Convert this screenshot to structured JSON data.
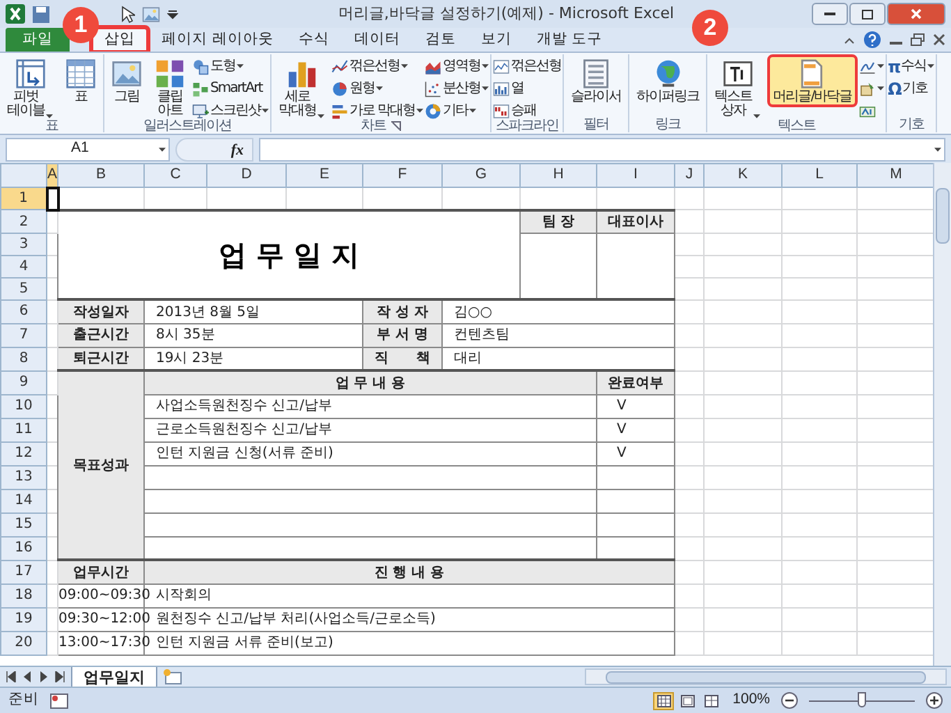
{
  "title_bar": {
    "title": "머리글,바닥글 설정하기(예제) - Microsoft Excel"
  },
  "annotations": [
    {
      "label": "1"
    },
    {
      "label": "2"
    }
  ],
  "ribbon_tabs": [
    {
      "label": "파일",
      "kind": "file",
      "selected": false,
      "highlighted": false
    },
    {
      "label": "삽입",
      "kind": "tab",
      "selected": true,
      "highlighted": true
    },
    {
      "label": "페이지 레이아웃",
      "kind": "tab",
      "selected": false,
      "highlighted": false
    },
    {
      "label": "수식",
      "kind": "tab",
      "selected": false,
      "highlighted": false
    },
    {
      "label": "데이터",
      "kind": "tab",
      "selected": false,
      "highlighted": false
    },
    {
      "label": "검토",
      "kind": "tab",
      "selected": false,
      "highlighted": false
    },
    {
      "label": "보기",
      "kind": "tab",
      "selected": false,
      "highlighted": false
    },
    {
      "label": "개발 도구",
      "kind": "tab",
      "selected": false,
      "highlighted": false
    }
  ],
  "ribbon_groups": [
    {
      "label": "표",
      "launcher": false,
      "commands": [
        {
          "kind": "large",
          "label": "피벗\n테이블",
          "dropdown": true,
          "highlighted": false
        },
        {
          "kind": "large",
          "label": "표",
          "dropdown": false,
          "highlighted": false
        }
      ]
    },
    {
      "label": "일러스트레이션",
      "launcher": false,
      "commands": [
        {
          "kind": "large",
          "label": "그림",
          "dropdown": false,
          "highlighted": false
        },
        {
          "kind": "large",
          "label": "클립\n아트",
          "dropdown": false,
          "highlighted": false
        },
        {
          "kind": "small",
          "label": "도형",
          "dropdown": true
        },
        {
          "kind": "small",
          "label": "SmartArt",
          "dropdown": false
        },
        {
          "kind": "small",
          "label": "스크린샷",
          "dropdown": true
        }
      ]
    },
    {
      "label": "차트",
      "launcher": true,
      "commands": [
        {
          "kind": "large",
          "label": "세로\n막대형",
          "dropdown": true,
          "highlighted": false
        },
        {
          "kind": "small",
          "label": "꺾은선형",
          "dropdown": true
        },
        {
          "kind": "small",
          "label": "원형",
          "dropdown": true
        },
        {
          "kind": "small",
          "label": "가로 막대형",
          "dropdown": true
        },
        {
          "kind": "small",
          "label": "영역형",
          "dropdown": true
        },
        {
          "kind": "small",
          "label": "분산형",
          "dropdown": true
        },
        {
          "kind": "small",
          "label": "기타",
          "dropdown": true
        }
      ]
    },
    {
      "label": "스파크라인",
      "launcher": false,
      "commands": [
        {
          "kind": "small",
          "label": "꺾은선형",
          "dropdown": false
        },
        {
          "kind": "small",
          "label": "열",
          "dropdown": false
        },
        {
          "kind": "small",
          "label": "승패",
          "dropdown": false
        }
      ]
    },
    {
      "label": "필터",
      "launcher": false,
      "commands": [
        {
          "kind": "large",
          "label": "슬라이서",
          "dropdown": false,
          "highlighted": false
        }
      ]
    },
    {
      "label": "링크",
      "launcher": false,
      "commands": [
        {
          "kind": "large",
          "label": "하이퍼링크",
          "dropdown": false,
          "highlighted": false
        }
      ]
    },
    {
      "label": "텍스트",
      "launcher": false,
      "commands": [
        {
          "kind": "large",
          "label": "텍스트\n상자",
          "dropdown": true,
          "highlighted": false
        },
        {
          "kind": "large",
          "label": "머리글/바닥글",
          "dropdown": false,
          "highlighted": true
        },
        {
          "kind": "icon",
          "dropdown": true
        },
        {
          "kind": "icon",
          "dropdown": true
        },
        {
          "kind": "icon",
          "dropdown": false
        }
      ]
    },
    {
      "label": "기호",
      "launcher": false,
      "commands": [
        {
          "kind": "small",
          "symbol": "π",
          "label": "수식",
          "dropdown": true
        },
        {
          "kind": "small",
          "symbol": "Ω",
          "label": "기호",
          "dropdown": false
        }
      ]
    }
  ],
  "formula_bar": {
    "name_box": "A1",
    "function_label": "fx"
  },
  "columns": [
    {
      "label": "A",
      "selected": true
    },
    {
      "label": "B",
      "selected": false
    },
    {
      "label": "C",
      "selected": false
    },
    {
      "label": "D",
      "selected": false
    },
    {
      "label": "E",
      "selected": false
    },
    {
      "label": "F",
      "selected": false
    },
    {
      "label": "G",
      "selected": false
    },
    {
      "label": "H",
      "selected": false
    },
    {
      "label": "I",
      "selected": false
    },
    {
      "label": "J",
      "selected": false
    },
    {
      "label": "K",
      "selected": false
    },
    {
      "label": "L",
      "selected": false
    },
    {
      "label": "M",
      "selected": false
    }
  ],
  "rows": [
    {
      "label": "1",
      "selected": true
    },
    {
      "label": "2",
      "selected": false
    },
    {
      "label": "3",
      "selected": false
    },
    {
      "label": "4",
      "selected": false
    },
    {
      "label": "5",
      "selected": false
    },
    {
      "label": "6",
      "selected": false
    },
    {
      "label": "7",
      "selected": false
    },
    {
      "label": "8",
      "selected": false
    },
    {
      "label": "9",
      "selected": false
    },
    {
      "label": "10",
      "selected": false
    },
    {
      "label": "11",
      "selected": false
    },
    {
      "label": "12",
      "selected": false
    },
    {
      "label": "13",
      "selected": false
    },
    {
      "label": "14",
      "selected": false
    },
    {
      "label": "15",
      "selected": false
    },
    {
      "label": "16",
      "selected": false
    },
    {
      "label": "17",
      "selected": false
    },
    {
      "label": "18",
      "selected": false
    },
    {
      "label": "19",
      "selected": false
    },
    {
      "label": "20",
      "selected": false
    }
  ],
  "form": {
    "title": "업 무 일 지",
    "approvals": [
      {
        "label": "팀 장"
      },
      {
        "label": "대표이사"
      }
    ],
    "info_rows": [
      {
        "label": "작성일자",
        "value": "2013년 8월 5일",
        "label_2": "작 성 자",
        "value_2": "김○○"
      },
      {
        "label": "출근시간",
        "value": "8시 35분",
        "label_2": "부 서 명",
        "value_2": "컨텐츠팀"
      },
      {
        "label": "퇴근시간",
        "value": "19시 23분",
        "label_2": "직　　책",
        "value_2": "대리"
      }
    ],
    "goals": {
      "label": "목표성과",
      "header": "업 무 내 용",
      "status_header": "완료여부",
      "items": [
        {
          "task": "사업소득원천징수 신고/납부",
          "status": "V"
        },
        {
          "task": "근로소득원천징수 신고/납부",
          "status": "V"
        },
        {
          "task": "인턴 지원금 신청(서류 준비)",
          "status": "V"
        }
      ]
    },
    "schedule": {
      "label": "업무시간",
      "header": "진 행 내 용",
      "items": [
        {
          "time": "09:00~09:30",
          "task": "시작회의"
        },
        {
          "time": "09:30~12:00",
          "task": "원천징수 신고/납부 처리(사업소득/근로소득)"
        },
        {
          "time": "13:00~17:30",
          "task": "인턴 지원금 서류 준비(보고)"
        }
      ]
    }
  },
  "sheet_tabs": [
    {
      "label": "업무일지",
      "selected": true
    }
  ],
  "status_bar": {
    "status": "준비",
    "view_buttons": [
      {
        "selected": true
      },
      {
        "selected": false
      },
      {
        "selected": false
      }
    ],
    "zoom": "100%",
    "zoom_slider": {
      "level": 0.5
    }
  }
}
